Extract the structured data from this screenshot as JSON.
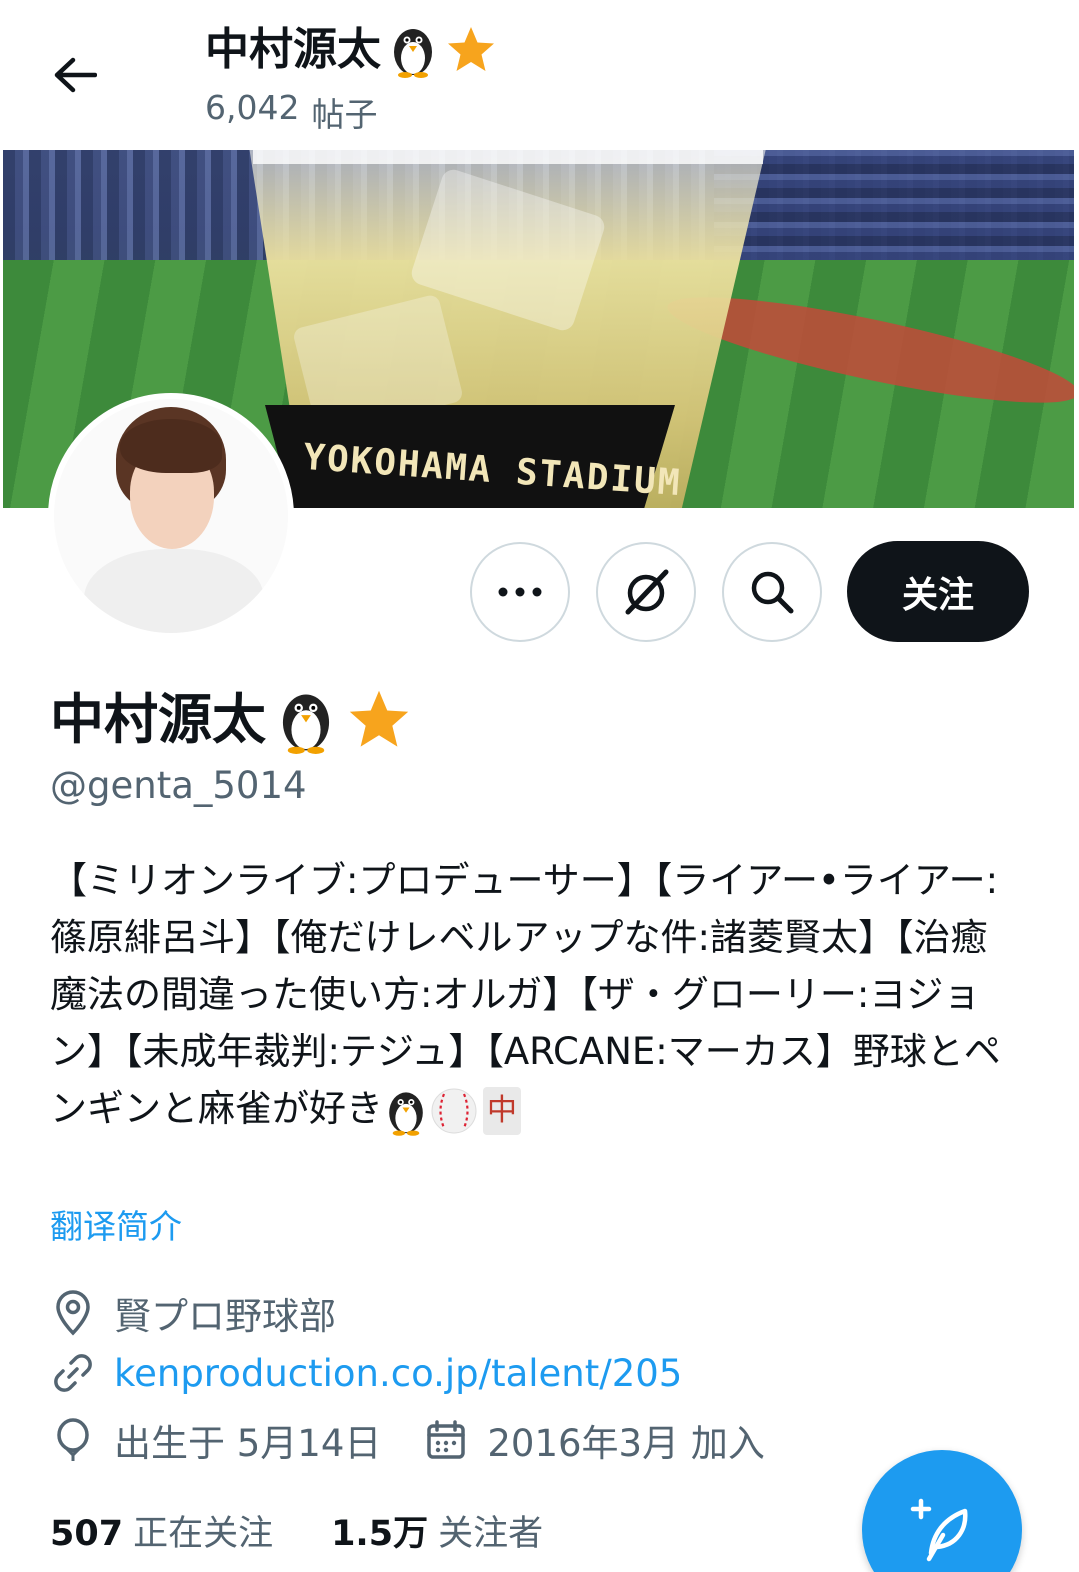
{
  "header": {
    "title": "中村源太",
    "post_count": "6,042",
    "post_label": "帖子"
  },
  "banner": {
    "printed_text": "YOKOHAMA STADIUM"
  },
  "actions": {
    "follow_label": "关注",
    "icons": [
      "more-icon",
      "grok-icon",
      "search-icon"
    ]
  },
  "profile": {
    "name": "中村源太",
    "name_emojis": [
      "penguin",
      "star"
    ],
    "handle": "@genta_5014",
    "bio": "【ミリオンライブ:プロデューサー】【ライアー•ライアー:篠原緋呂斗】【俺だけレベルアップな件:諸菱賢太】【治癒魔法の間違った使い方:オルガ】【ザ・グローリー:ヨジョン】【未成年裁判:テジュ】【ARCANE:マーカス】野球とペンギンと麻雀が好き",
    "bio_emojis": [
      "penguin",
      "baseball",
      "mahjong-red-dragon"
    ],
    "mahjong_glyph": "中",
    "translate_label": "翻译简介",
    "location": "賢プロ野球部",
    "link": "kenproduction.co.jp/talent/205",
    "birthday": "出生于 5月14日",
    "joined": "2016年3月 加入"
  },
  "stats": {
    "following_count": "507",
    "following_label": "正在关注",
    "followers_count": "1.5万",
    "followers_label": "关注者"
  },
  "colors": {
    "accent": "#1d9bf0",
    "text": "#0f1419",
    "muted": "#536471",
    "star": "#f7a41d"
  }
}
